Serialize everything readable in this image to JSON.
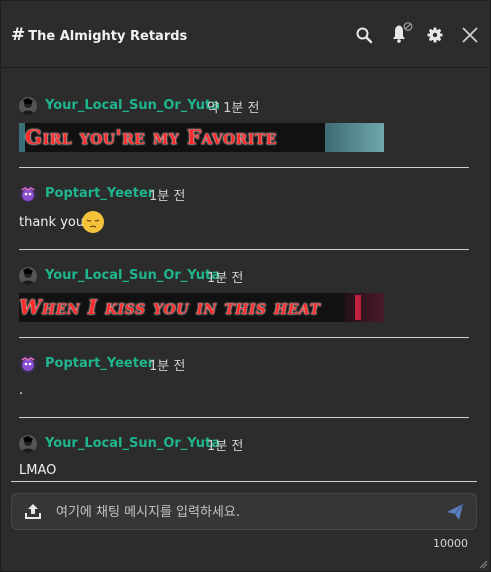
{
  "header": {
    "title": "The Almighty Retards",
    "icons": [
      "search-icon",
      "bell-muted-icon",
      "gear-icon",
      "close-icon"
    ]
  },
  "messages": [
    {
      "username": "Your_Local_Sun_Or_Yuta",
      "time": "약 1분 전",
      "type": "gif",
      "gif_caption": "Girl you're my Favorite"
    },
    {
      "username": "Poptart_Yeeter",
      "time": "1분 전",
      "type": "text",
      "text": "thank you",
      "emoji": "pensive-face"
    },
    {
      "username": "Your_Local_Sun_Or_Yuta",
      "time": "1분 전",
      "type": "gif",
      "gif_caption": "When I kiss you in this heat"
    },
    {
      "username": "Poptart_Yeeter",
      "time": "1분 전",
      "type": "text",
      "text": "."
    },
    {
      "username": "Your_Local_Sun_Or_Yuta",
      "time": "1분 전",
      "type": "text",
      "text": "LMAO"
    }
  ],
  "composer": {
    "placeholder": "여기에 채팅 메시지를 입력하세요.",
    "char_limit": "10000"
  },
  "colors": {
    "username": "#1fb58f",
    "background": "#2c2c2c",
    "send": "#5b7fbf"
  }
}
